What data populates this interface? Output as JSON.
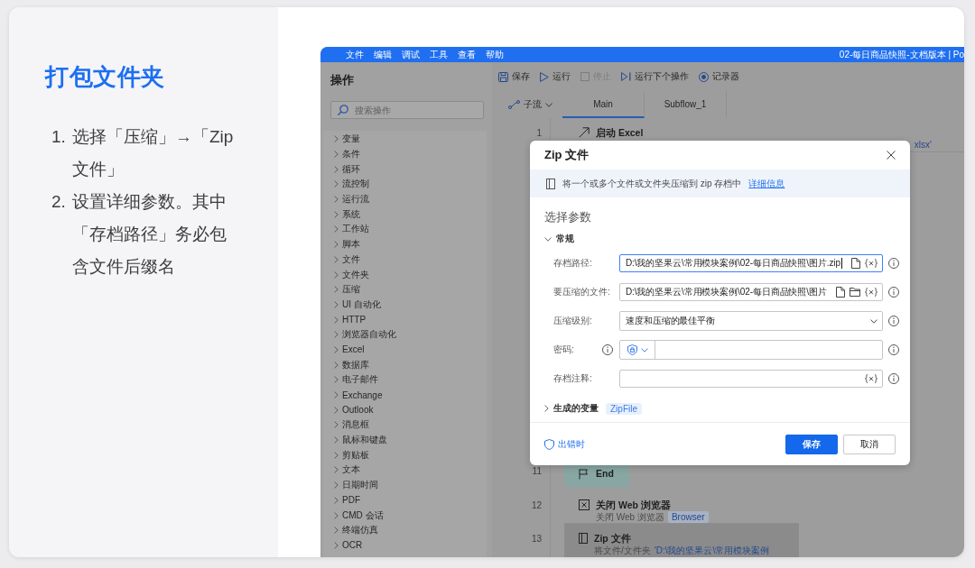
{
  "guide": {
    "title": "打包文件夹",
    "steps": [
      {
        "number": "1.",
        "text": "选择「压缩」→「Zip 文件」"
      },
      {
        "number": "2.",
        "text": "设置详细参数。其中「存档路径」务必包含文件后缀名"
      }
    ]
  },
  "app": {
    "menu": [
      "文件",
      "编辑",
      "调试",
      "工具",
      "查看",
      "帮助"
    ],
    "window_title": "02-每日商品快照-文档版本 | Po",
    "actions": {
      "title": "操作",
      "search": {
        "placeholder": "搜索操作"
      },
      "categories": [
        "变量",
        "条件",
        "循环",
        "流控制",
        "运行流",
        "系统",
        "工作站",
        "脚本",
        "文件",
        "文件夹",
        "压缩",
        "UI 自动化",
        "HTTP",
        "浏览器自动化",
        "Excel",
        "数据库",
        "电子邮件",
        "Exchange",
        "Outlook",
        "消息框",
        "鼠标和键盘",
        "剪贴板",
        "文本",
        "日期时间",
        "PDF",
        "CMD 会话",
        "终端仿真",
        "OCR"
      ]
    },
    "toolbar": [
      {
        "kind": "save",
        "label": "保存",
        "disabled": false
      },
      {
        "kind": "run",
        "label": "运行",
        "disabled": false
      },
      {
        "kind": "stop",
        "label": "停止",
        "disabled": true
      },
      {
        "kind": "step",
        "label": "运行下个操作",
        "disabled": false
      },
      {
        "kind": "record",
        "label": "记录器",
        "disabled": false
      }
    ],
    "subflows": {
      "label": "子流"
    },
    "tabs": [
      {
        "label": "Main",
        "selected": true
      },
      {
        "label": "Subflow_1",
        "selected": false
      }
    ],
    "flow": [
      {
        "number": "1",
        "kind": "launch",
        "title": "启动 Excel",
        "selected": false,
        "details": [
          {
            "kind": "trailing-value",
            "text": "xlsx'"
          }
        ]
      },
      {
        "number": "11",
        "kind": "end",
        "title": "End",
        "selected": false
      },
      {
        "number": "12",
        "kind": "close",
        "title": "关闭 Web 浏览器",
        "selected": false,
        "details": [
          {
            "kind": "text",
            "text": "关闭 Web 浏览器"
          },
          {
            "kind": "chip",
            "text": "Browser"
          }
        ]
      },
      {
        "number": "13",
        "kind": "zip",
        "title": "Zip 文件",
        "selected": true,
        "details": [
          {
            "kind": "text",
            "text": "将文件/文件夹"
          },
          {
            "kind": "value",
            "text": "'D:\\我的坚果云\\常用模块案例"
          }
        ]
      }
    ]
  },
  "dialog": {
    "title": "Zip 文件",
    "description": "将一个或多个文件或文件夹压缩到 zip 存档中",
    "link": "详细信息",
    "heading": "选择参数",
    "group": {
      "label": "常规",
      "expanded": true
    },
    "fields": [
      {
        "kind": "file",
        "label": "存档路径:",
        "value": "D:\\我的坚果云\\常用模块案例\\02-每日商品快照\\图片.zip",
        "focused": true
      },
      {
        "kind": "files",
        "label": "要压缩的文件:",
        "value": "D:\\我的坚果云\\常用模块案例\\02-每日商品快照\\图片",
        "focused": false
      },
      {
        "kind": "select",
        "label": "压缩级别:",
        "value": "速度和压缩的最佳平衡",
        "focused": false
      },
      {
        "kind": "password",
        "label": "密码:",
        "focused": false
      },
      {
        "kind": "text",
        "label": "存档注释:",
        "focused": false
      }
    ],
    "outputs": {
      "label": "生成的变量",
      "expanded": false,
      "variables": [
        "ZipFile"
      ]
    },
    "on_error": "出错时",
    "buttons": [
      {
        "kind": "primary",
        "label": "保存"
      },
      {
        "kind": "secondary",
        "label": "取消"
      }
    ]
  }
}
